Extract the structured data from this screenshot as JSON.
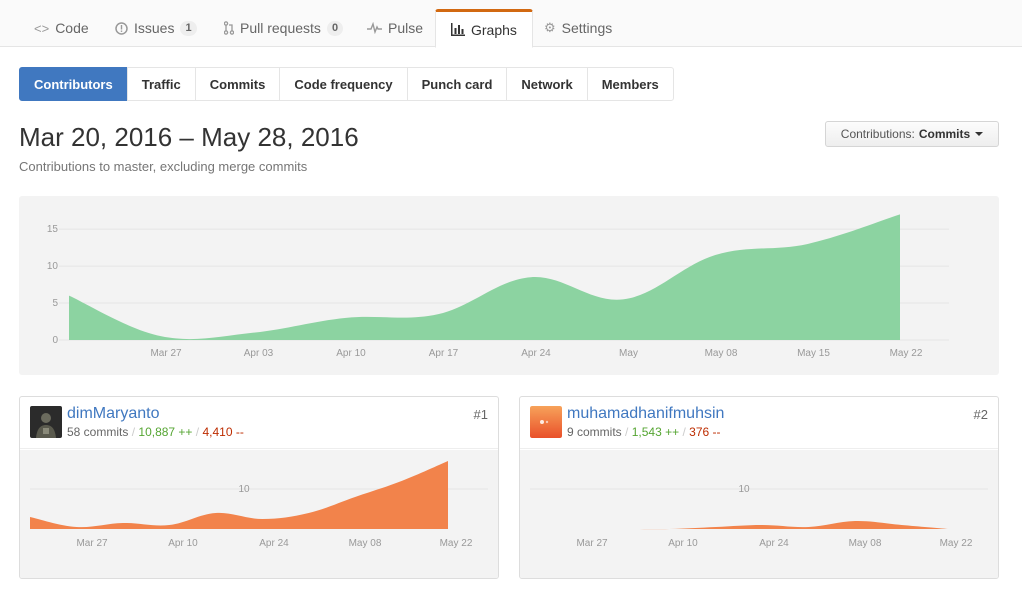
{
  "repo_nav": {
    "tabs": [
      {
        "label": "Code",
        "icon": "code-icon"
      },
      {
        "label": "Issues",
        "icon": "issue-icon",
        "count": "1"
      },
      {
        "label": "Pull requests",
        "icon": "pull-request-icon",
        "count": "0"
      },
      {
        "label": "Pulse",
        "icon": "pulse-icon"
      },
      {
        "label": "Graphs",
        "icon": "graph-icon",
        "selected": true
      },
      {
        "label": "Settings",
        "icon": "gear-icon"
      }
    ]
  },
  "subnav": {
    "items": [
      "Contributors",
      "Traffic",
      "Commits",
      "Code frequency",
      "Punch card",
      "Network",
      "Members"
    ],
    "selected": "Contributors"
  },
  "page": {
    "title": "Mar 20, 2016 – May 28, 2016",
    "subtitle": "Contributions to master, excluding merge commits",
    "dropdown_prefix": "Contributions:",
    "dropdown_value": "Commits"
  },
  "colors": {
    "main_fill": "#8cd3a1",
    "contributor_fill": "#f2834b",
    "accent": "#4078c0",
    "additions": "#55a532",
    "deletions": "#bd2c00"
  },
  "chart_data": [
    {
      "type": "area",
      "title": "",
      "x": [
        "Mar 20",
        "Mar 27",
        "Apr 03",
        "Apr 10",
        "Apr 17",
        "Apr 24",
        "May 01",
        "May 08",
        "May 15",
        "May 22"
      ],
      "x_tick_labels": [
        "Mar 27",
        "Apr 03",
        "Apr 10",
        "Apr 17",
        "Apr 24",
        "May",
        "May 08",
        "May 15",
        "May 22"
      ],
      "series": [
        {
          "values": [
            6,
            0.5,
            1,
            3,
            3.5,
            8.5,
            5.5,
            11.5,
            13,
            17
          ]
        }
      ],
      "ylim": [
        0,
        18
      ],
      "y_ticks": [
        0,
        5,
        10,
        15
      ],
      "grid": true
    },
    {
      "type": "area",
      "title": "",
      "x": [
        "Mar 20",
        "Mar 27",
        "Apr 03",
        "Apr 10",
        "Apr 17",
        "Apr 24",
        "May 01",
        "May 08",
        "May 15",
        "May 22"
      ],
      "x_tick_labels": [
        "Mar 27",
        "Apr 10",
        "Apr 24",
        "May 08",
        "May 22"
      ],
      "series": [
        {
          "values": [
            3,
            0.5,
            1.5,
            1,
            4,
            2.5,
            4,
            8,
            12,
            17
          ]
        }
      ],
      "y_ticks": [
        10
      ],
      "ylim": [
        0,
        19
      ]
    },
    {
      "type": "area",
      "title": "",
      "x": [
        "Mar 20",
        "Mar 27",
        "Apr 03",
        "Apr 10",
        "Apr 17",
        "Apr 24",
        "May 01",
        "May 08",
        "May 15",
        "May 22"
      ],
      "x_tick_labels": [
        "Mar 27",
        "Apr 10",
        "Apr 24",
        "May 08",
        "May 22"
      ],
      "series": [
        {
          "values": [
            0,
            0,
            0,
            0,
            0.5,
            1,
            0.5,
            2,
            1,
            0
          ]
        }
      ],
      "y_ticks": [
        10
      ],
      "ylim": [
        0,
        19
      ]
    }
  ],
  "contributors": [
    {
      "login": "dimMaryanto",
      "commits": "58 commits",
      "additions": "10,887 ++",
      "deletions": "4,410 --",
      "rank": "#1"
    },
    {
      "login": "muhamadhanifmuhsin",
      "commits": "9 commits",
      "additions": "1,543 ++",
      "deletions": "376 --",
      "rank": "#2"
    }
  ]
}
